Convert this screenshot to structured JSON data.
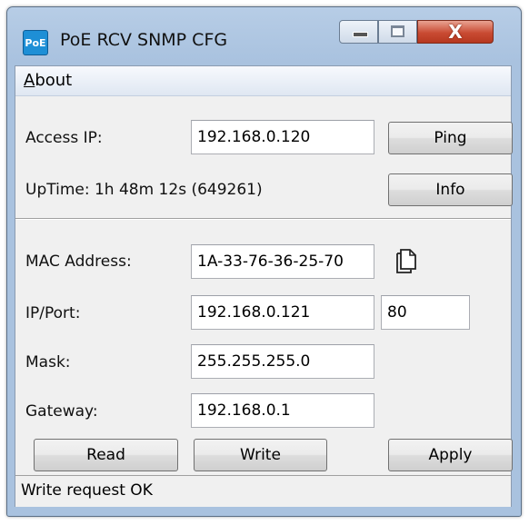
{
  "window": {
    "title": "PoE RCV SNMP CFG",
    "icon_text": "PoE",
    "close_glyph": "X"
  },
  "menu": {
    "about_mnemonic": "A",
    "about_rest": "bout"
  },
  "access": {
    "ip_label": "Access IP:",
    "ip_value": "192.168.0.120",
    "ping_label": "Ping",
    "uptime_text": "UpTime: 1h 48m 12s (649261)",
    "info_label": "Info"
  },
  "config": {
    "mac_label": "MAC Address:",
    "mac_value": "1A-33-76-36-25-70",
    "ipport_label": "IP/Port:",
    "ip_value": "192.168.0.121",
    "port_value": "80",
    "mask_label": "Mask:",
    "mask_value": "255.255.255.0",
    "gateway_label": "Gateway:",
    "gateway_value": "192.168.0.1"
  },
  "buttons": {
    "read": "Read",
    "write": "Write",
    "apply": "Apply"
  },
  "status": {
    "text": "Write request OK"
  },
  "icons": {
    "app": "poe-app-icon",
    "copy": "copy-icon",
    "minimize": "minimize-icon",
    "maximize": "maximize-icon",
    "close": "close-icon"
  },
  "colors": {
    "title_frame": "#a9c2df",
    "close_button": "#c94b33",
    "client_bg": "#f0f0f0"
  }
}
